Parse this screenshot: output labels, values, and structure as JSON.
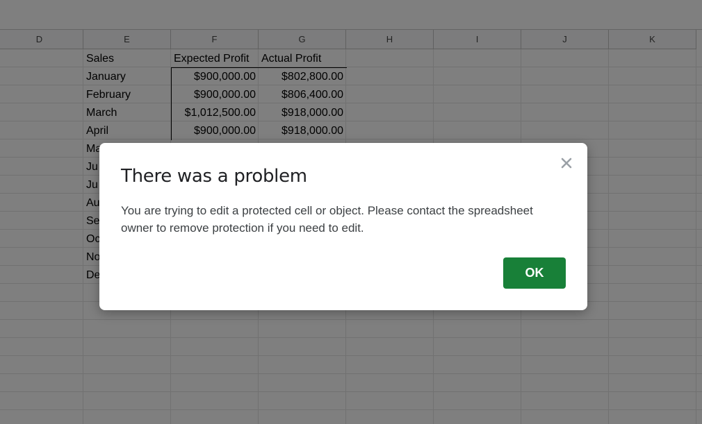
{
  "columns": [
    "D",
    "E",
    "F",
    "G",
    "H",
    "I",
    "J",
    "K"
  ],
  "table": {
    "headers": [
      "Sales",
      "Expected Profit",
      "Actual Profit"
    ],
    "rows": [
      [
        "January",
        "$900,000.00",
        "$802,800.00"
      ],
      [
        "February",
        "$900,000.00",
        "$806,400.00"
      ],
      [
        "March",
        "$1,012,500.00",
        "$918,000.00"
      ],
      [
        "April",
        "$900,000.00",
        "$918,000.00"
      ],
      [
        "Ma",
        "",
        ""
      ],
      [
        "Ju",
        "",
        ""
      ],
      [
        "Ju",
        "",
        ""
      ],
      [
        "Au",
        "",
        ""
      ],
      [
        "Se",
        "",
        ""
      ],
      [
        "Oc",
        "",
        ""
      ],
      [
        "No",
        "",
        ""
      ],
      [
        "De",
        "",
        ""
      ]
    ]
  },
  "dialog": {
    "title": "There was a problem",
    "message": "You are trying to edit a protected cell or object. Please contact the spreadsheet owner to remove protection if you need to edit.",
    "ok_label": "OK",
    "close_icon": "close-icon"
  },
  "colors": {
    "ok_button": "#188038",
    "overlay": "rgba(0,0,0,0.5)"
  }
}
